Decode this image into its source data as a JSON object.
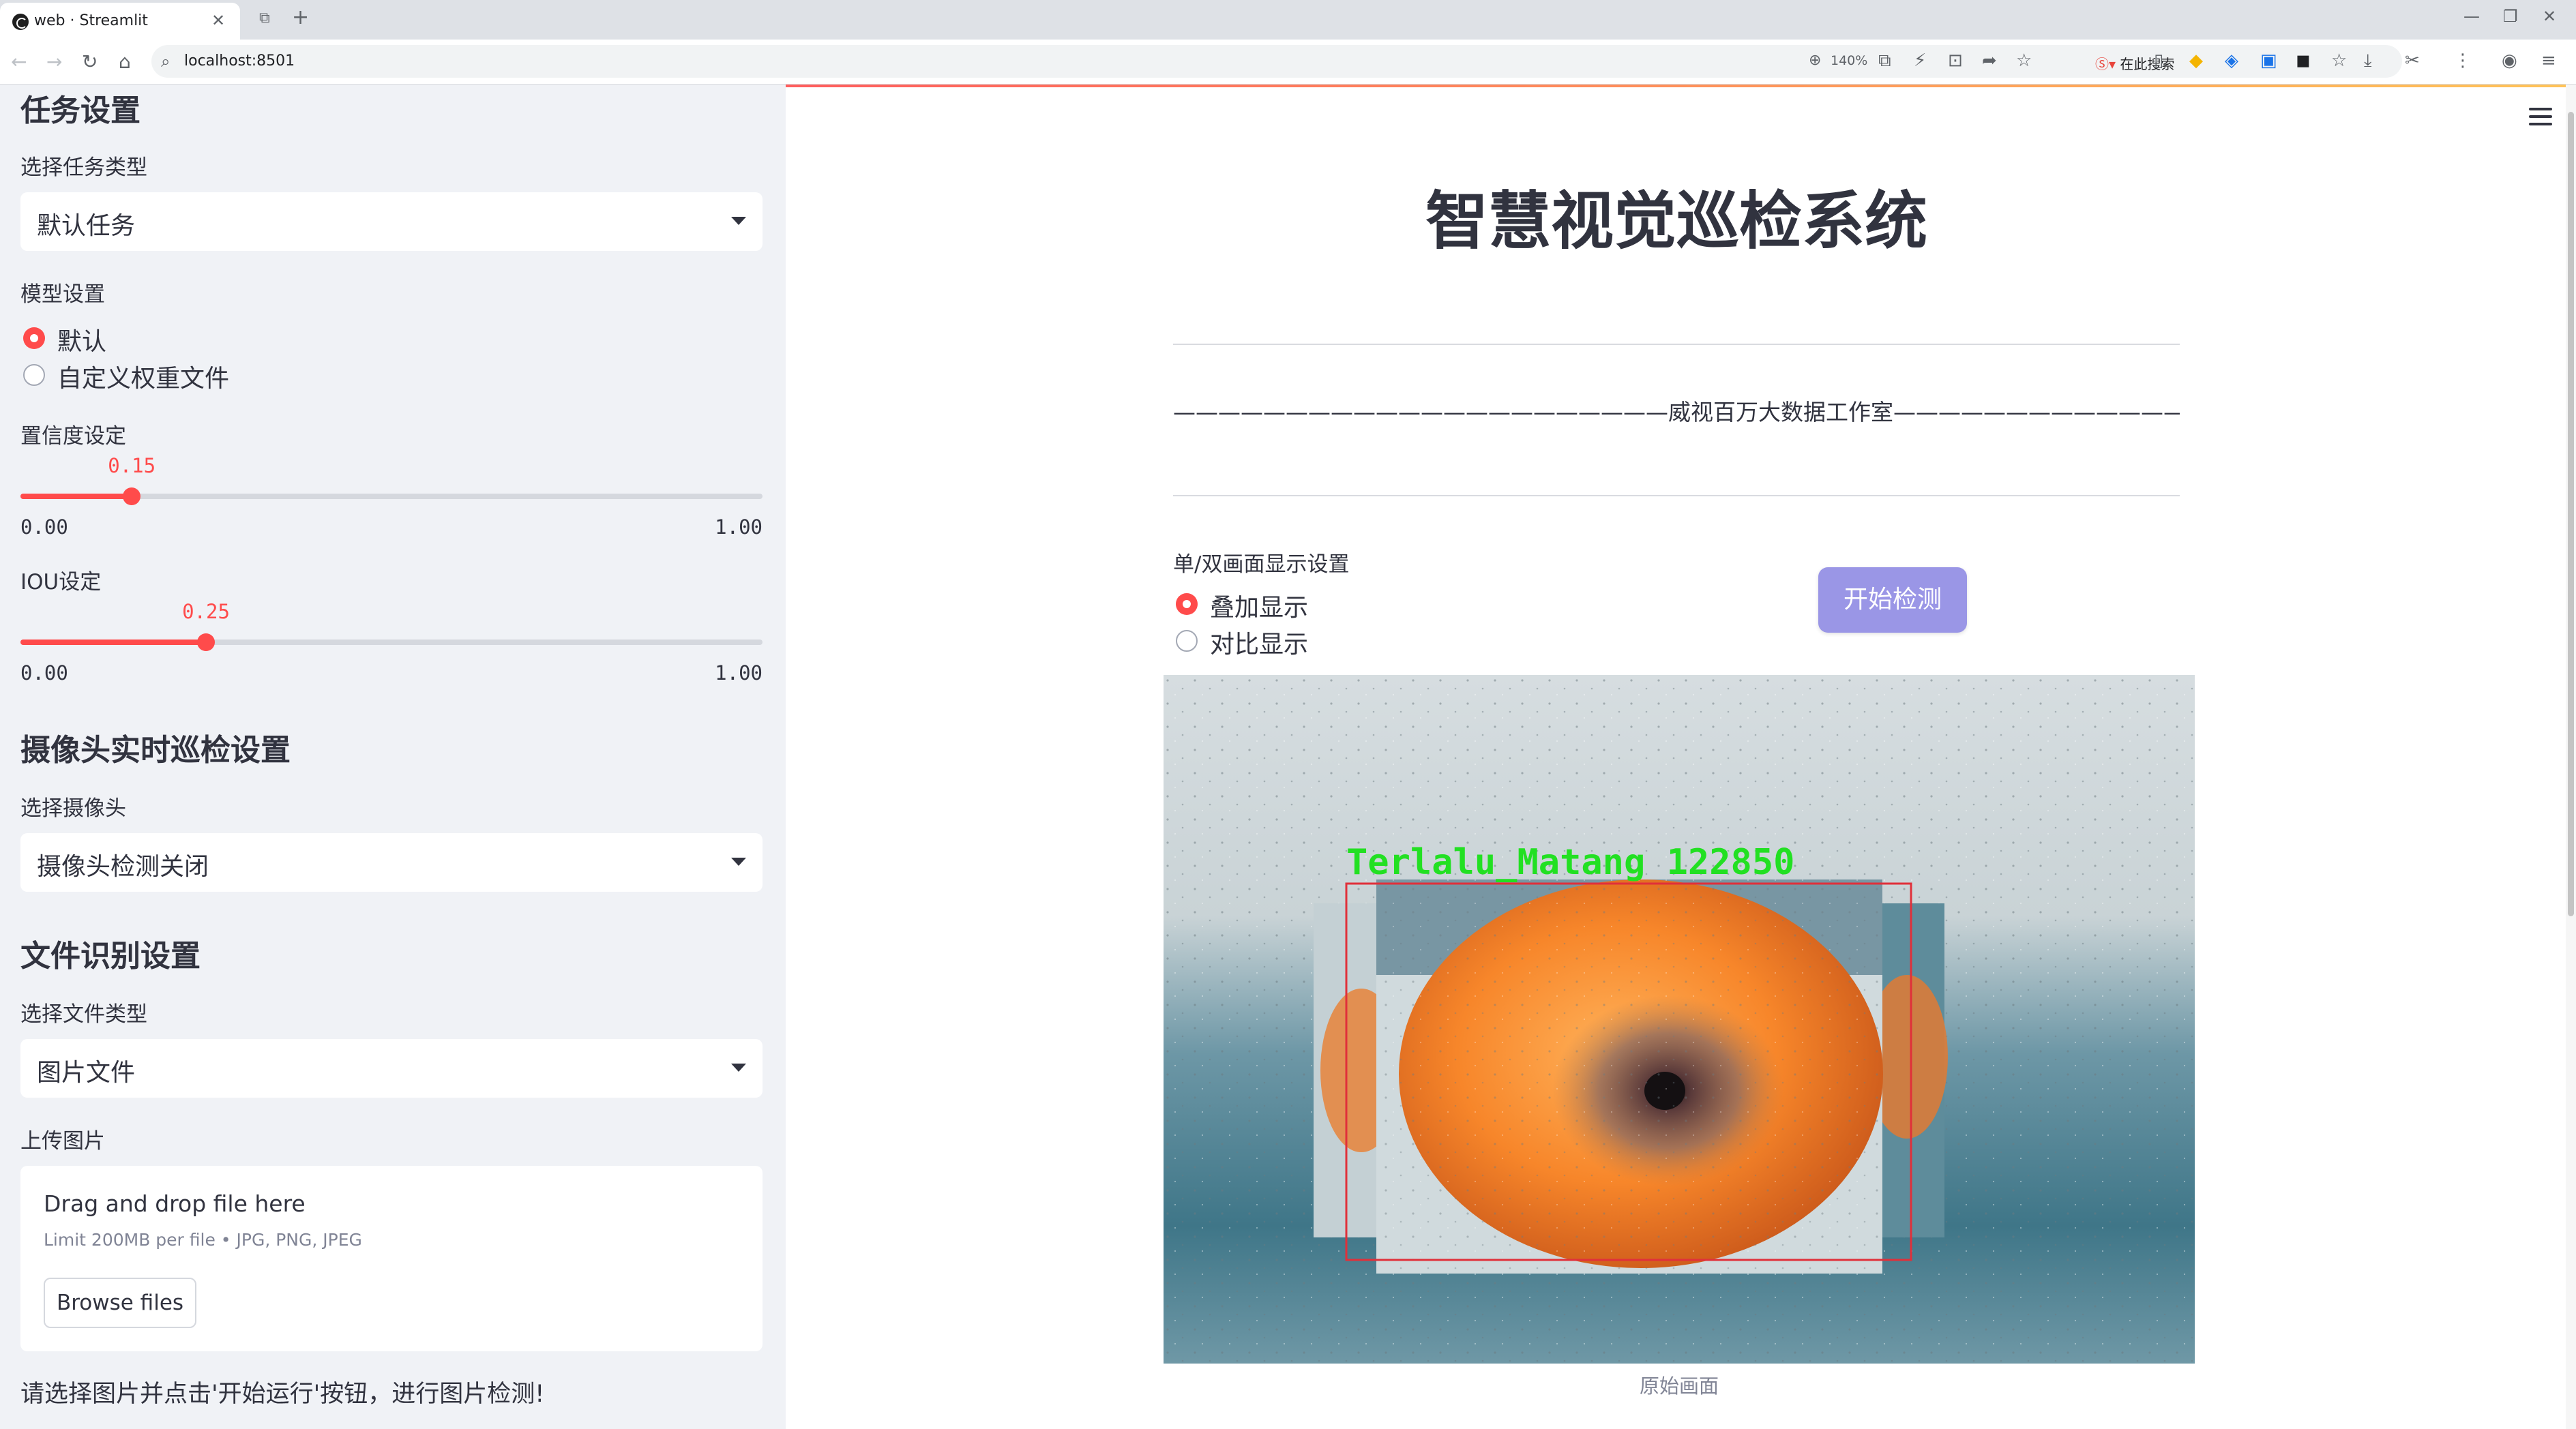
{
  "browser": {
    "tab_title": "web · Streamlit",
    "url": "localhost:8501",
    "zoom": "140%",
    "search_engine": "在此搜索"
  },
  "sidebar": {
    "task_section": "任务设置",
    "task_type_label": "选择任务类型",
    "task_type_value": "默认任务",
    "model_label": "模型设置",
    "model_options": [
      "默认",
      "自定义权重文件"
    ],
    "model_selected": 0,
    "confidence": {
      "label": "置信度设定",
      "value": "0.15",
      "min": "0.00",
      "max": "1.00",
      "fraction": 0.15
    },
    "iou": {
      "label": "IOU设定",
      "value": "0.25",
      "min": "0.00",
      "max": "1.00",
      "fraction": 0.25
    },
    "camera_section": "摄像头实时巡检设置",
    "camera_label": "选择摄像头",
    "camera_value": "摄像头检测关闭",
    "file_section": "文件识别设置",
    "file_type_label": "选择文件类型",
    "file_type_value": "图片文件",
    "upload_label": "上传图片",
    "upload_title": "Drag and drop file here",
    "upload_limit": "Limit 200MB per file • JPG, PNG, JPEG",
    "browse_button": "Browse files",
    "note": "请选择图片并点击'开始运行'按钮，进行图片检测!"
  },
  "main": {
    "title": "智慧视觉巡检系统",
    "studio": "——————————————————————威视百万大数据工作室————————————————————————",
    "display_label": "单/双画面显示设置",
    "display_options": [
      "叠加显示",
      "对比显示"
    ],
    "display_selected": 0,
    "start_button": "开始检测",
    "detection_label": "Terlalu_Matang  122850",
    "caption": "原始画面"
  },
  "colors": {
    "accent": "#ff4b4b",
    "button": "#9a96e6",
    "detect_text": "#22e022",
    "detect_box": "#e0303a",
    "sidebar_bg": "#f0f2f6"
  }
}
